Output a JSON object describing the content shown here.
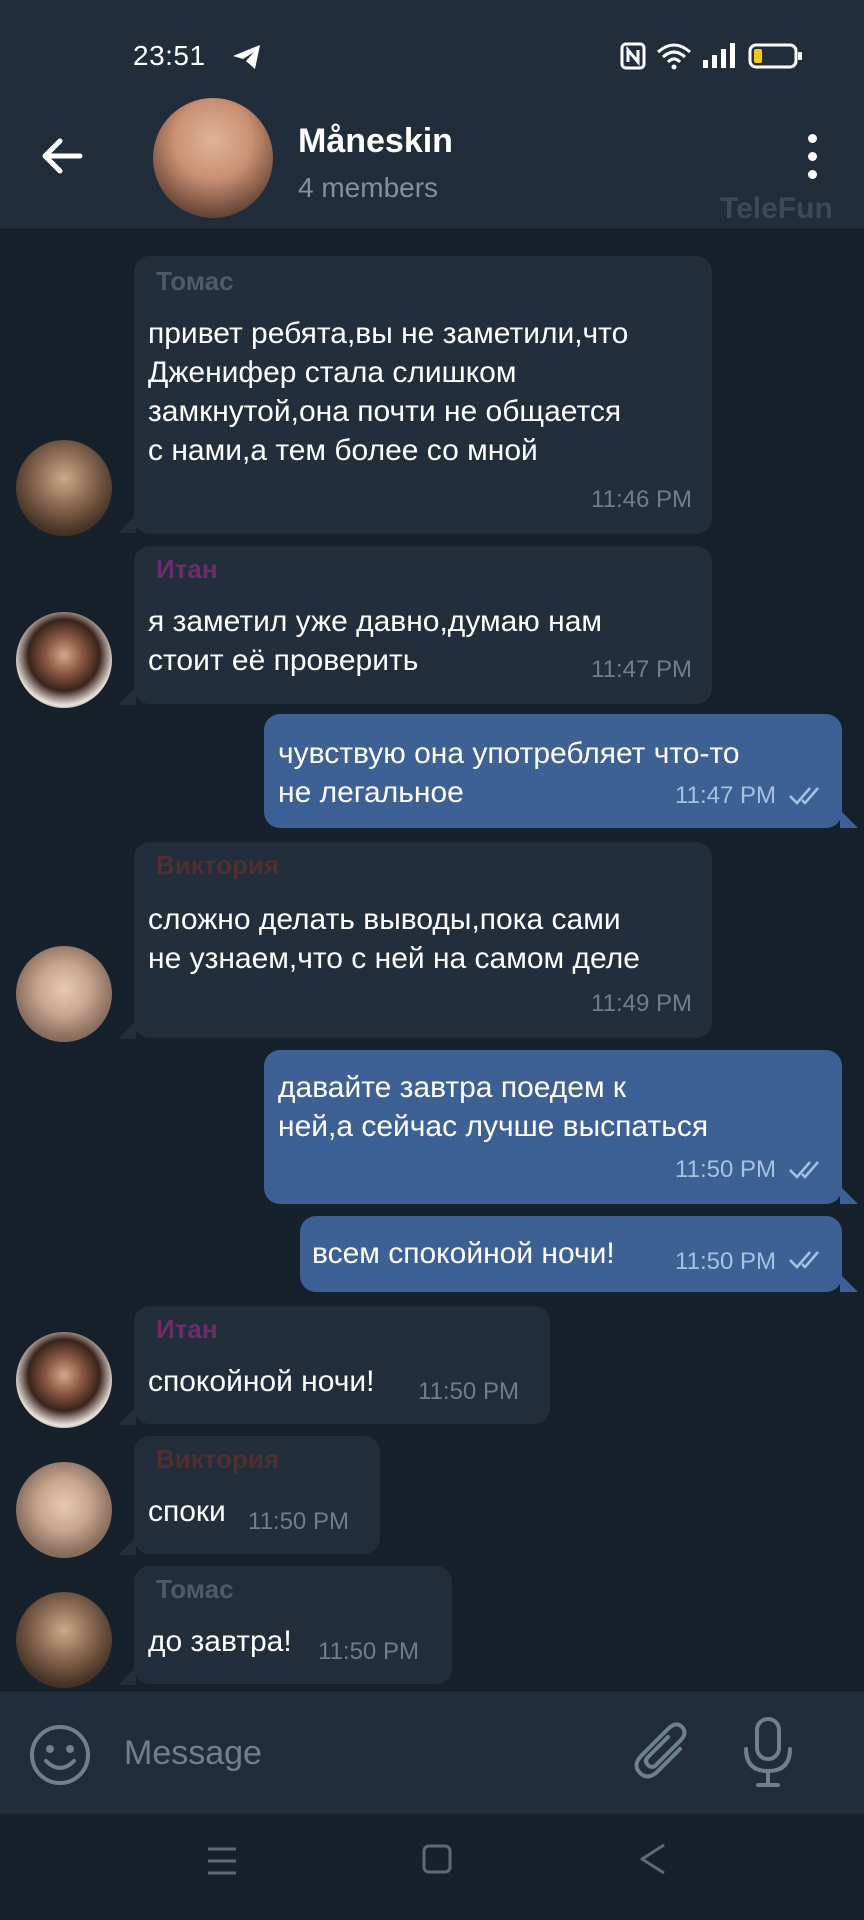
{
  "status_bar": {
    "time": "23:51",
    "battery_color": "#f5c518"
  },
  "header": {
    "title": "Måneskin",
    "subtitle": "4 members",
    "watermark": "TeleFun"
  },
  "messages": [
    {
      "sender": "Томас",
      "sender_color": "#4e5b69",
      "text": "привет ребята,вы не заметили,что\nДженифер стала слишком\nзамкнутой,она почти не общается\nс нами,а тем более со мной",
      "time": "11:46 PM",
      "direction": "in"
    },
    {
      "sender": "Итан",
      "sender_color": "#6b2e6b",
      "text": "я заметил уже давно,думаю нам\nстоит её проверить",
      "time": "11:47 PM",
      "direction": "in"
    },
    {
      "text": "чувствую она употребляет что-то\nне легальное",
      "time": "11:47 PM",
      "direction": "out",
      "status": "read"
    },
    {
      "sender": "Виктория",
      "sender_color": "#4f2f30",
      "text": "сложно делать выводы,пока сами\nне узнаем,что с ней на самом деле",
      "time": "11:49 PM",
      "direction": "in"
    },
    {
      "text": "давайте завтра поедем к\nней,а сейчас лучше выспаться",
      "time": "11:50 PM",
      "direction": "out",
      "status": "read"
    },
    {
      "text": "всем спокойной ночи!",
      "time": "11:50 PM",
      "direction": "out",
      "status": "read"
    },
    {
      "sender": "Итан",
      "sender_color": "#6b2e6b",
      "text": "спокойной ночи!",
      "time": "11:50 PM",
      "direction": "in"
    },
    {
      "sender": "Виктория",
      "sender_color": "#4f2f30",
      "text": "споки",
      "time": "11:50 PM",
      "direction": "in"
    },
    {
      "sender": "Томас",
      "sender_color": "#4e5b69",
      "text": "до завтра!",
      "time": "11:50 PM",
      "direction": "in"
    }
  ],
  "composer": {
    "placeholder": "Message"
  },
  "colors": {
    "background": "#17212b",
    "header": "#212d3b",
    "incoming": "#232e3c",
    "outgoing": "#3e6195"
  },
  "icons": {
    "back": "arrow-left-icon",
    "menu": "more-vertical-icon",
    "emoji": "smile-icon",
    "attach": "paperclip-icon",
    "mic": "microphone-icon",
    "read": "double-check-icon"
  }
}
